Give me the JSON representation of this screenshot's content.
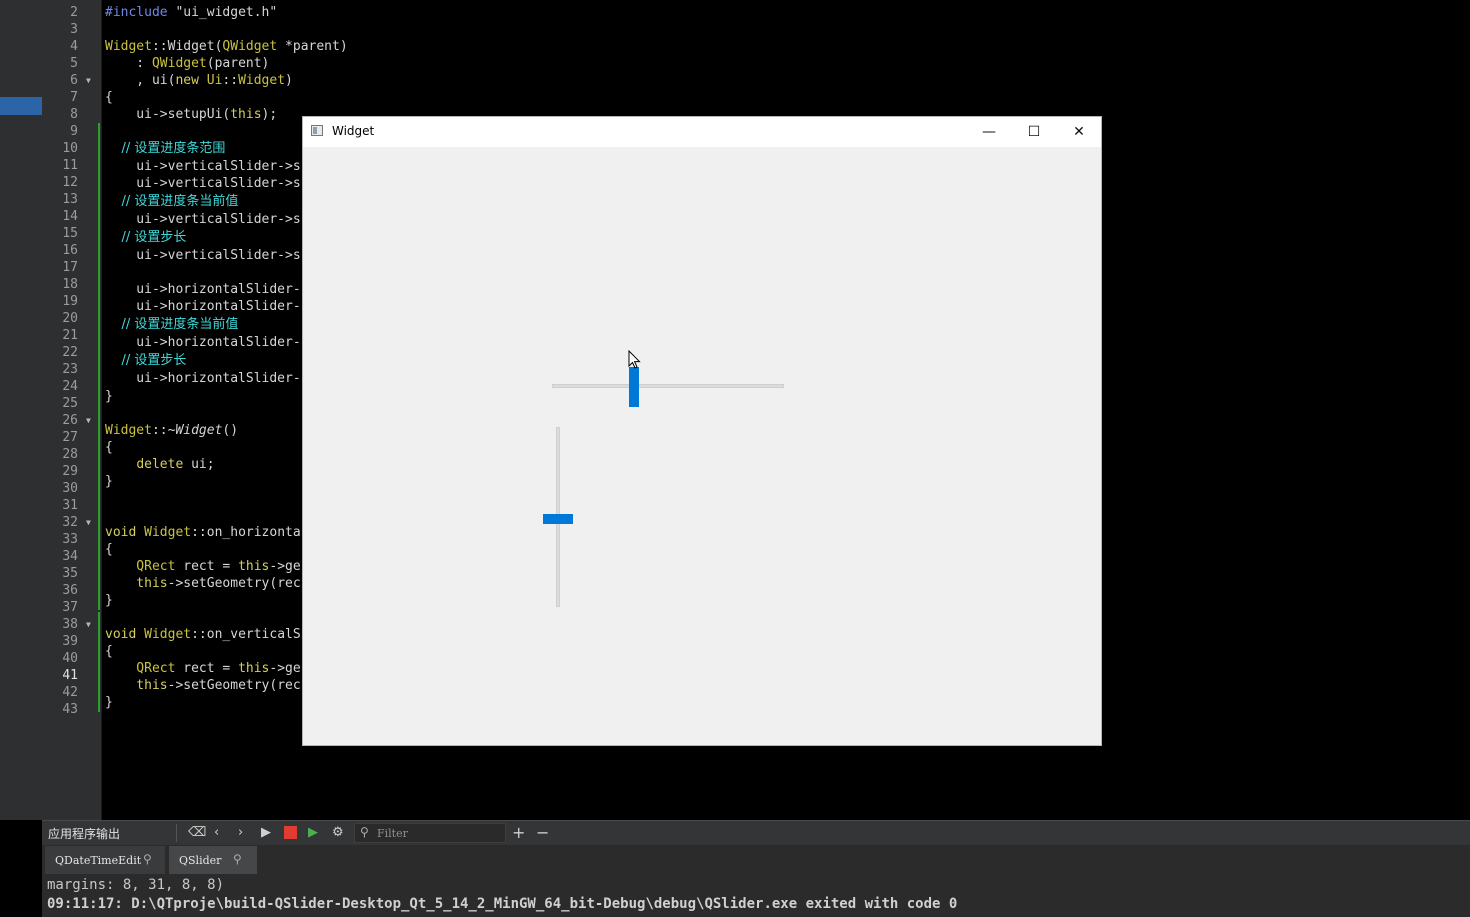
{
  "editor": {
    "lines": [
      {
        "n": "2"
      },
      {
        "n": "3"
      },
      {
        "n": "4"
      },
      {
        "n": "5"
      },
      {
        "n": "6"
      },
      {
        "n": "7"
      },
      {
        "n": "8"
      },
      {
        "n": "9"
      },
      {
        "n": "10"
      },
      {
        "n": "11"
      },
      {
        "n": "12"
      },
      {
        "n": "13"
      },
      {
        "n": "14"
      },
      {
        "n": "15"
      },
      {
        "n": "16"
      },
      {
        "n": "17"
      },
      {
        "n": "18"
      },
      {
        "n": "19"
      },
      {
        "n": "20"
      },
      {
        "n": "21"
      },
      {
        "n": "22"
      },
      {
        "n": "23"
      },
      {
        "n": "24"
      },
      {
        "n": "25"
      },
      {
        "n": "26"
      },
      {
        "n": "27"
      },
      {
        "n": "28"
      },
      {
        "n": "29"
      },
      {
        "n": "30"
      },
      {
        "n": "31"
      },
      {
        "n": "32"
      },
      {
        "n": "33"
      },
      {
        "n": "34"
      },
      {
        "n": "35"
      },
      {
        "n": "36"
      },
      {
        "n": "37"
      },
      {
        "n": "38"
      },
      {
        "n": "39"
      },
      {
        "n": "40"
      },
      {
        "n": "41"
      },
      {
        "n": "42"
      },
      {
        "n": "43"
      }
    ],
    "current_line": "41",
    "code": {
      "l2_pp": "#include ",
      "l2_str": "\"ui_widget.h\"",
      "l4_a": "Widget",
      "l4_b": "::",
      "l4_c": "Widget",
      "l4_d": "(",
      "l4_e": "QWidget",
      "l4_f": " *parent)",
      "l5_a": "    : ",
      "l5_b": "QWidget",
      "l5_c": "(parent)",
      "l6_a": "    , ui(",
      "l6_b": "new",
      "l6_c": " Ui",
      "l6_d": "::",
      "l6_e": "Widget",
      "l6_f": ")",
      "l7": "{",
      "l8_a": "    ui->setupUi(",
      "l8_b": "this",
      "l8_c": ");",
      "l10": "    // 设置进度条范围",
      "l11": "    ui->verticalSlider->s",
      "l12": "    ui->verticalSlider->s",
      "l13": "    // 设置进度条当前值",
      "l14": "    ui->verticalSlider->s",
      "l15": "    // 设置步长",
      "l16": "    ui->verticalSlider->s",
      "l18": "    ui->horizontalSlider-",
      "l19": "    ui->horizontalSlider-",
      "l20": "    // 设置进度条当前值",
      "l21": "    ui->horizontalSlider-",
      "l22": "    // 设置步长",
      "l23": "    ui->horizontalSlider-",
      "l24": "}",
      "l26_a": "Widget",
      "l26_b": "::~",
      "l26_c": "Widget",
      "l26_d": "()",
      "l27": "{",
      "l28_a": "    ",
      "l28_b": "delete",
      "l28_c": " ui;",
      "l29": "}",
      "l32_a": "void",
      "l32_b": " Widget",
      "l32_c": "::on_horizonta",
      "l33": "{",
      "l34_a": "    QRect",
      "l34_b": " rect = ",
      "l34_c": "this",
      "l34_d": "->ge",
      "l35_a": "    this",
      "l35_b": "->setGeometry(rec",
      "l36": "}",
      "l38_a": "void",
      "l38_b": " Widget",
      "l38_c": "::on_verticalS",
      "l39": "{",
      "l40_a": "    QRect",
      "l40_b": " rect = ",
      "l40_c": "this",
      "l40_d": "->ge",
      "l41_a": "    this",
      "l41_b": "->setGeometry(rec",
      "l42": "}"
    }
  },
  "widget_window": {
    "title": "Widget",
    "minimize_glyph": "—",
    "maximize_glyph": "☐",
    "close_glyph": "✕"
  },
  "output_pane": {
    "title": "应用程序输出",
    "filter_placeholder": "Filter",
    "tabs": [
      {
        "label": "QDateTimeEdit"
      },
      {
        "label": "QSlider"
      }
    ],
    "lines": [
      "margins: 8, 31, 8, 8)",
      "09:11:17: D:\\QTproje\\build-QSlider-Desktop_Qt_5_14_2_MinGW_64_bit-Debug\\debug\\QSlider.exe exited with code 0"
    ]
  },
  "colors": {
    "accent": "#0078d7",
    "editor_bg": "#000000",
    "gutter_bg": "#2e2f30",
    "comment": "#3fd8d8",
    "keyword": "#d6cf5c"
  },
  "icons": {
    "toolbar": [
      "clean-icon",
      "previous-icon",
      "next-icon",
      "run-icon",
      "stop-icon",
      "debug-run-icon",
      "settings-icon",
      "search-icon",
      "add-icon",
      "remove-icon"
    ]
  }
}
